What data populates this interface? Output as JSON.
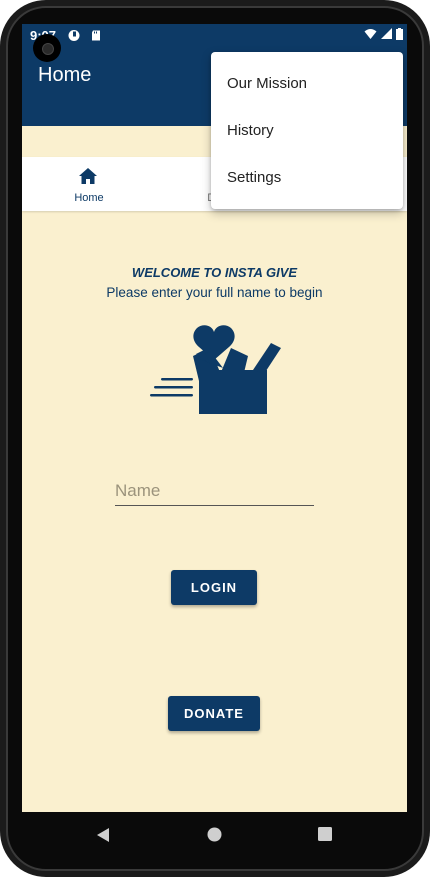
{
  "status_bar": {
    "time": "9:07",
    "icons": [
      "circle-status-icon",
      "sd-card-icon",
      "wifi-icon",
      "signal-icon",
      "battery-icon"
    ]
  },
  "app_bar": {
    "title": "Home"
  },
  "overflow_menu": {
    "items": [
      {
        "label": "Our Mission"
      },
      {
        "label": "History"
      },
      {
        "label": "Settings"
      }
    ]
  },
  "tabs": [
    {
      "label": "Home",
      "icon": "home-icon",
      "active": true
    },
    {
      "label": "Das",
      "icon": "dashboard-icon",
      "active": false
    }
  ],
  "welcome": {
    "title": "WELCOME TO INSTA GIVE",
    "subtitle": "Please enter your full name to begin"
  },
  "form": {
    "name_placeholder": "Name",
    "name_value": ""
  },
  "buttons": {
    "login_label": "LOGIN",
    "donate_label": "DONATE"
  },
  "nav_bar": {
    "icons": [
      "back-icon",
      "home-circle-icon",
      "recents-icon"
    ]
  },
  "colors": {
    "primary": "#0d3a66",
    "background": "#faf0cf",
    "surface": "#ffffff"
  }
}
